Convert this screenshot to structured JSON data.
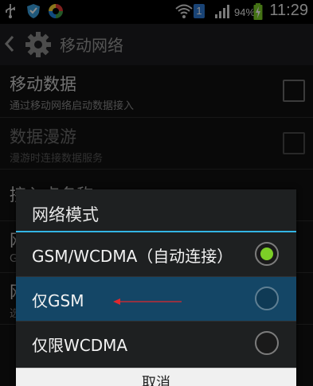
{
  "status_bar": {
    "usb_icon": "usb-icon",
    "shield_icon": "shield-icon",
    "app_icon": "colorful-app-icon",
    "wifi_icon": "wifi-icon",
    "sim_badge": "1",
    "signal_icon": "signal-icon",
    "battery_percent": "94%",
    "battery_icon": "battery-charging-icon",
    "time": "11:29"
  },
  "action_bar": {
    "title": "移动网络"
  },
  "settings": {
    "items": [
      {
        "title": "移动数据",
        "subtitle": "通过移动网络启动数据接入"
      },
      {
        "title": "数据漫游",
        "subtitle": "漫游时连接数据服务"
      },
      {
        "title": "接入点名称",
        "subtitle": ""
      },
      {
        "title": "网",
        "subtitle": "G"
      },
      {
        "title": "网",
        "subtitle": "选"
      }
    ]
  },
  "dialog": {
    "title": "网络模式",
    "options": [
      {
        "label": "GSM/WCDMA（自动连接）",
        "selected": true
      },
      {
        "label": "仅GSM",
        "selected": false
      },
      {
        "label": "仅限WCDMA",
        "selected": false
      }
    ],
    "cancel_label": "取消"
  },
  "colors": {
    "accent": "#33b5e5",
    "selected_radio": "#7ccf27",
    "highlight_row": "#144666",
    "annotation_arrow": "#e0282e"
  }
}
